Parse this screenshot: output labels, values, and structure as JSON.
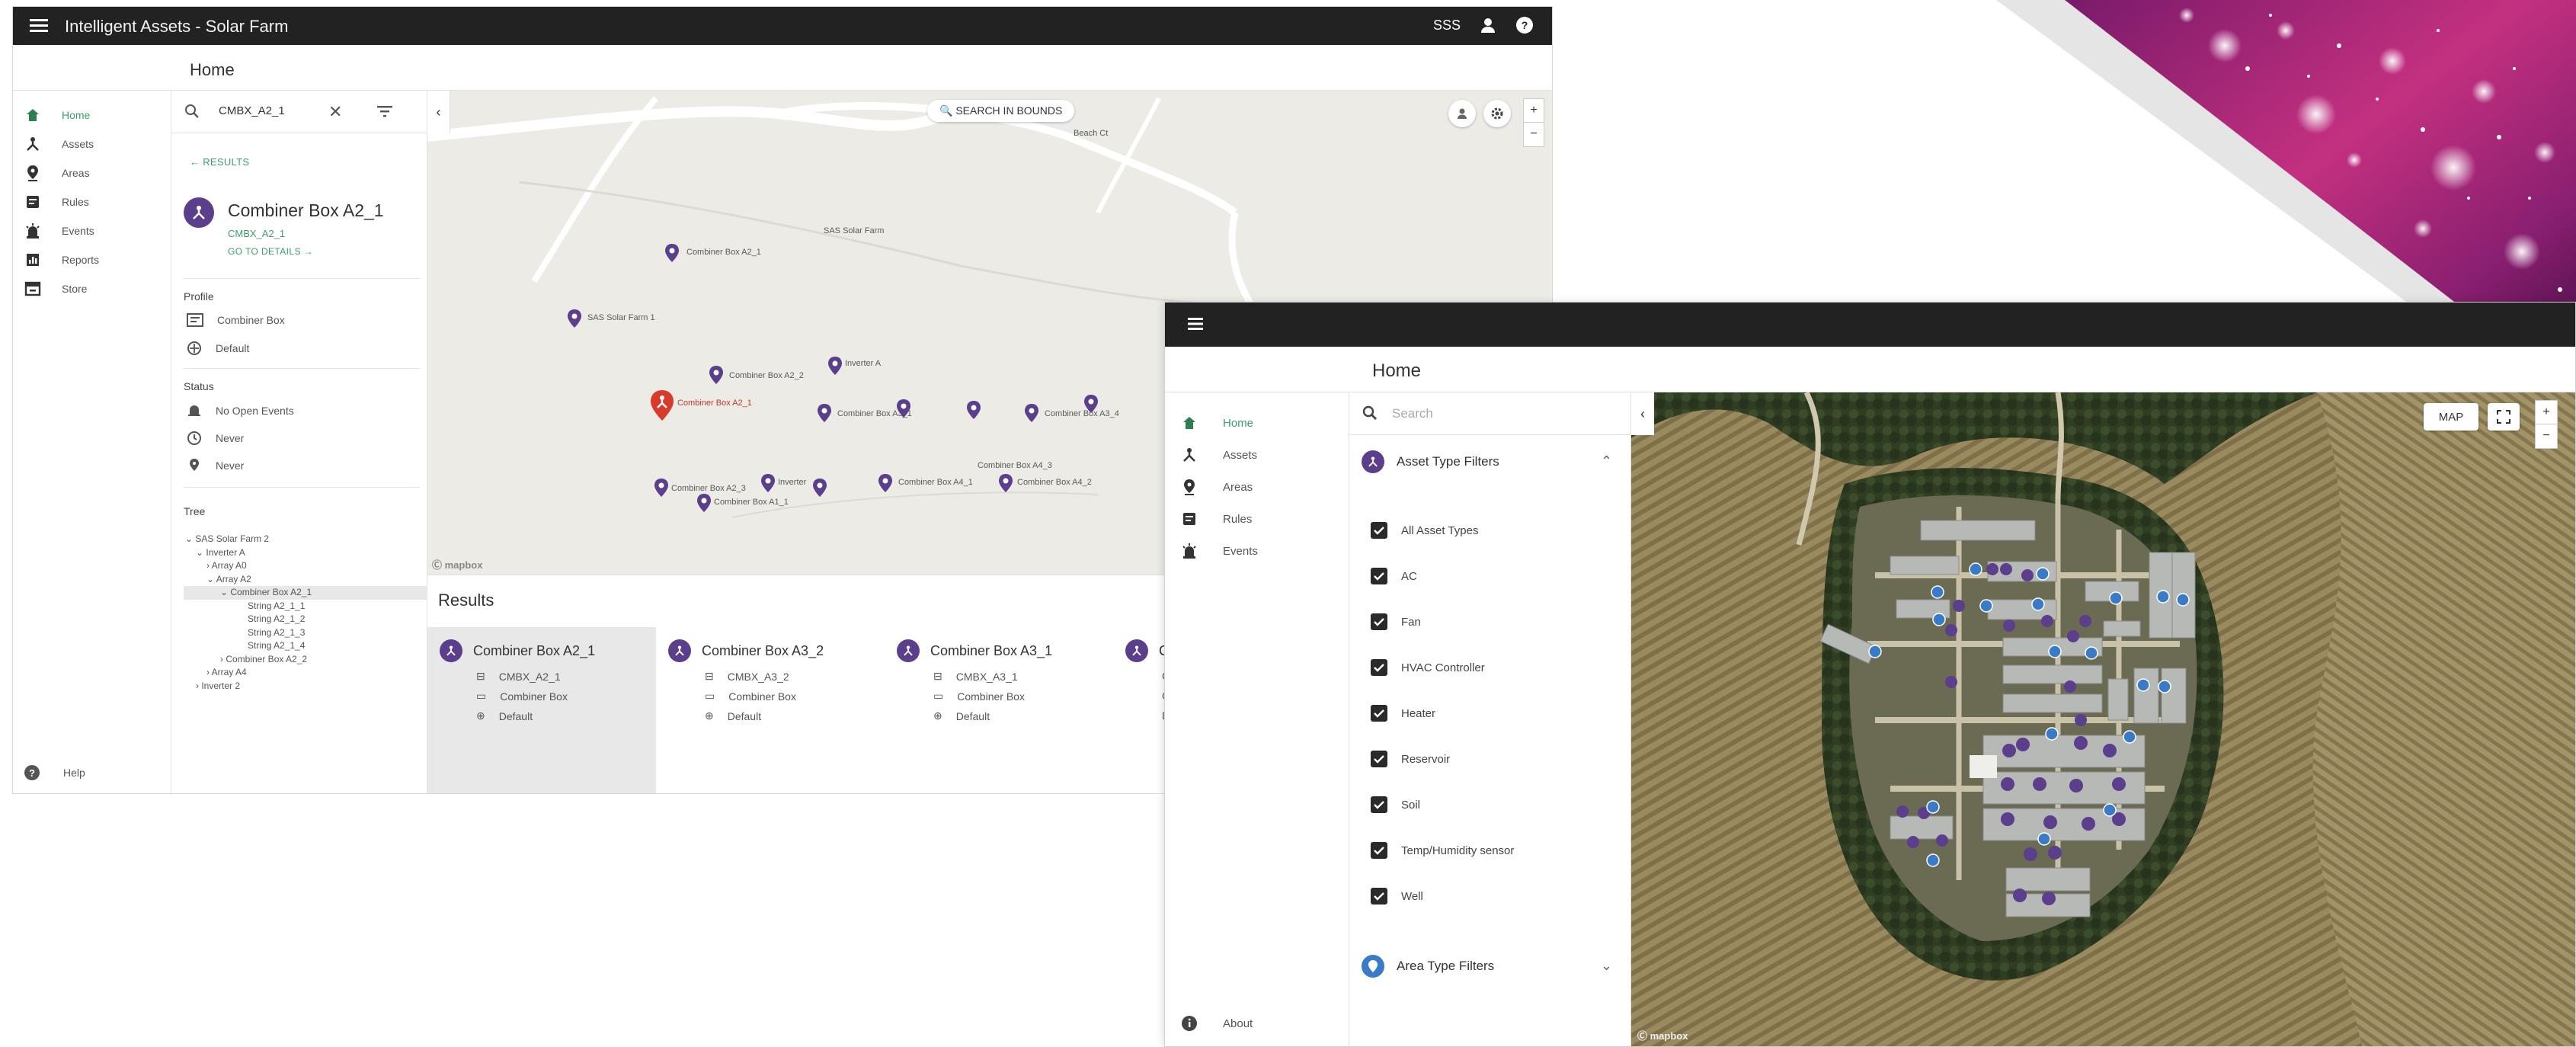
{
  "window1": {
    "title": "Intelligent Assets - Solar Farm",
    "topbar_right_label": "SSS",
    "breadcrumb": "Home",
    "nav": [
      {
        "label": "Home",
        "icon": "home-icon"
      },
      {
        "label": "Assets",
        "icon": "assets-icon"
      },
      {
        "label": "Areas",
        "icon": "location-pin-icon"
      },
      {
        "label": "Rules",
        "icon": "rules-icon"
      },
      {
        "label": "Events",
        "icon": "alarm-icon"
      },
      {
        "label": "Reports",
        "icon": "reports-icon"
      },
      {
        "label": "Store",
        "icon": "store-icon"
      }
    ],
    "help_label": "Help",
    "search_value": "CMBX_A2_1",
    "back_label": "← RESULTS",
    "asset": {
      "name": "Combiner Box A2_1",
      "id": "CMBX_A2_1",
      "details_link": "GO TO DETAILS →"
    },
    "profile": {
      "heading": "Profile",
      "type": "Combiner Box",
      "template": "Default"
    },
    "status": {
      "heading": "Status",
      "events": "No Open Events",
      "updated": "Never",
      "location": "Never"
    },
    "tree": {
      "heading": "Tree",
      "items": [
        "⌄ SAS Solar Farm 2",
        "⌄ Inverter A",
        "› Array A0",
        "⌄ Array A2",
        "⌄ Combiner Box A2_1",
        "String A2_1_1",
        "String A2_1_2",
        "String A2_1_3",
        "String A2_1_4",
        "› Combiner Box A2_2",
        "› Array A4",
        "› Inverter 2"
      ]
    },
    "map": {
      "search_in_bounds": "🔍 SEARCH IN BOUNDS",
      "road_label": "Beach Ct",
      "place_label": "SAS Solar Farm",
      "markers": [
        {
          "label": "Combiner Box A2_1"
        },
        {
          "label": "SAS Solar Farm 1"
        },
        {
          "label": "Combiner Box A2_2"
        },
        {
          "label": "Inverter A"
        },
        {
          "label": "Combiner Box A2_1"
        },
        {
          "label": "Combiner Box A3_1"
        },
        {
          "label": "Combiner Box A3_4"
        },
        {
          "label": "Combiner Box A2_3"
        },
        {
          "label": "Inverter"
        },
        {
          "label": "Combiner Box A4_1"
        },
        {
          "label": "Combiner Box A4_2"
        },
        {
          "label": "Combiner Box A4_3"
        },
        {
          "label": "Combiner Box A1_1"
        }
      ],
      "zoom_in": "+",
      "zoom_out": "−",
      "logo": "Ⓒ mapbox"
    },
    "results": {
      "title": "Results",
      "cards": [
        {
          "name": "Combiner Box A2_1",
          "id": "CMBX_A2_1",
          "type": "Combiner Box",
          "template": "Default"
        },
        {
          "name": "Combiner Box A3_2",
          "id": "CMBX_A3_2",
          "type": "Combiner Box",
          "template": "Default"
        },
        {
          "name": "Combiner Box A3_1",
          "id": "CMBX_A3_1",
          "type": "Combiner Box",
          "template": "Default"
        },
        {
          "name": "Co",
          "id": "C",
          "type": "C",
          "template": "D"
        }
      ]
    }
  },
  "window2": {
    "breadcrumb": "Home",
    "nav": [
      {
        "label": "Home",
        "icon": "home-icon"
      },
      {
        "label": "Assets",
        "icon": "assets-icon"
      },
      {
        "label": "Areas",
        "icon": "location-pin-icon"
      },
      {
        "label": "Rules",
        "icon": "rules-icon"
      },
      {
        "label": "Events",
        "icon": "alarm-icon"
      }
    ],
    "about_label": "About",
    "search_placeholder": "Search",
    "asset_filters": {
      "heading": "Asset Type Filters",
      "items": [
        "All Asset Types",
        "AC",
        "Fan",
        "HVAC Controller",
        "Heater",
        "Reservoir",
        "Soil",
        "Temp/Humidity sensor",
        "Well"
      ]
    },
    "area_filters": {
      "heading": "Area Type Filters"
    },
    "map": {
      "map_button": "MAP",
      "zoom_in": "+",
      "zoom_out": "−",
      "logo": "Ⓒ mapbox"
    }
  },
  "colors": {
    "topbar": "#222222",
    "accent_green": "#3b9e6a",
    "asset_purple": "#5b3e8c",
    "selected_marker_red": "#d93b2b",
    "area_blue": "#3a7bc8"
  }
}
